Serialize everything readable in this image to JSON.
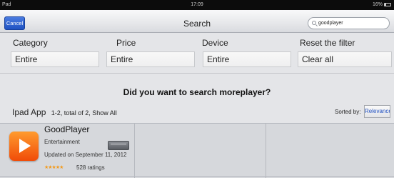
{
  "status_bar": {
    "device": "Pad",
    "time": "17:09",
    "battery": "16%"
  },
  "nav": {
    "cancel_label": "Cancel",
    "title": "Search",
    "search_value": "goodplayer"
  },
  "filters": [
    {
      "label": "Category",
      "value": "Entire"
    },
    {
      "label": "Price",
      "value": "Entire"
    },
    {
      "label": "Device",
      "value": "Entire"
    },
    {
      "label": "Reset the filter",
      "value": "Clear all"
    }
  ],
  "suggestion": "Did you want to search moreplayer?",
  "results": {
    "section": "Ipad App",
    "count_text": "1-2, total of 2, Show All",
    "sort_label": "Sorted by:",
    "sort_value": "Relevance"
  },
  "apps": [
    {
      "name": "GoodPlayer",
      "category": "Entertainment",
      "updated": "Updated on September 11, 2012",
      "stars": "★★★★★",
      "ratings": "528 ratings"
    }
  ]
}
